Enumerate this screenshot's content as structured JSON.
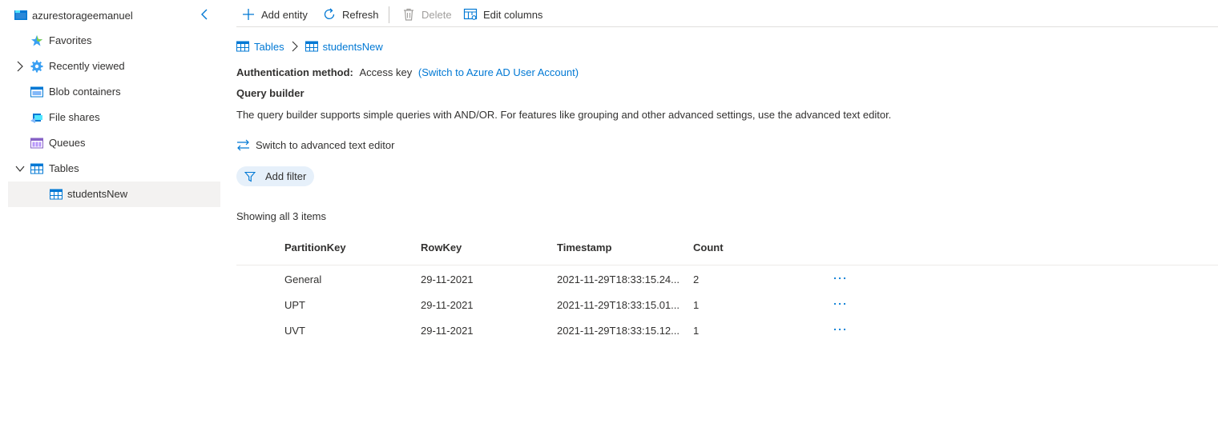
{
  "sidebar": {
    "account": "azurestorageemanuel",
    "items": [
      {
        "label": "Favorites"
      },
      {
        "label": "Recently viewed"
      },
      {
        "label": "Blob containers"
      },
      {
        "label": "File shares"
      },
      {
        "label": "Queues"
      },
      {
        "label": "Tables"
      },
      {
        "label": "studentsNew"
      }
    ]
  },
  "toolbar": {
    "add_entity": "Add entity",
    "refresh": "Refresh",
    "delete": "Delete",
    "edit_columns": "Edit columns"
  },
  "breadcrumb": {
    "root": "Tables",
    "current": "studentsNew"
  },
  "auth": {
    "label": "Authentication method:",
    "value": "Access key",
    "switch_link": "(Switch to Azure AD User Account)"
  },
  "query_builder": {
    "title": "Query builder",
    "description": "The query builder supports simple queries with AND/OR. For features like grouping and other advanced settings, use the advanced text editor.",
    "switch_advanced": "Switch to advanced text editor",
    "add_filter": "Add filter"
  },
  "results": {
    "summary": "Showing all 3 items",
    "columns": [
      "PartitionKey",
      "RowKey",
      "Timestamp",
      "Count"
    ],
    "rows": [
      {
        "partition_key": "General",
        "row_key": "29-11-2021",
        "timestamp": "2021-11-29T18:33:15.24...",
        "count": "2"
      },
      {
        "partition_key": "UPT",
        "row_key": "29-11-2021",
        "timestamp": "2021-11-29T18:33:15.01...",
        "count": "1"
      },
      {
        "partition_key": "UVT",
        "row_key": "29-11-2021",
        "timestamp": "2021-11-29T18:33:15.12...",
        "count": "1"
      }
    ]
  },
  "colors": {
    "accent": "#0078d4",
    "text": "#323130",
    "selected_bg": "#f3f2f1",
    "filter_pill_bg": "#e6f0fa"
  }
}
